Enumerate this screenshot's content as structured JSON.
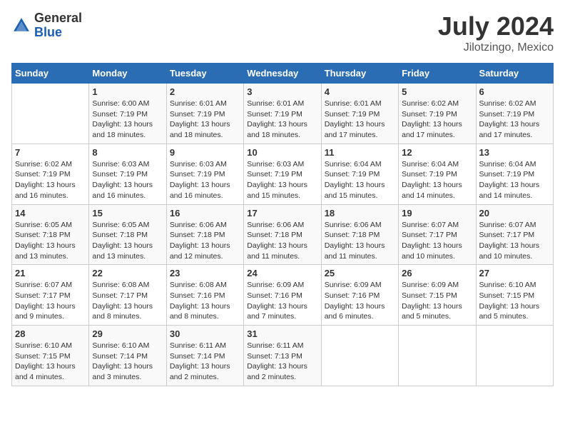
{
  "header": {
    "logo_general": "General",
    "logo_blue": "Blue",
    "month_title": "July 2024",
    "location": "Jilotzingo, Mexico"
  },
  "calendar": {
    "days_of_week": [
      "Sunday",
      "Monday",
      "Tuesday",
      "Wednesday",
      "Thursday",
      "Friday",
      "Saturday"
    ],
    "weeks": [
      [
        {
          "day": "",
          "info": ""
        },
        {
          "day": "1",
          "info": "Sunrise: 6:00 AM\nSunset: 7:19 PM\nDaylight: 13 hours\nand 18 minutes."
        },
        {
          "day": "2",
          "info": "Sunrise: 6:01 AM\nSunset: 7:19 PM\nDaylight: 13 hours\nand 18 minutes."
        },
        {
          "day": "3",
          "info": "Sunrise: 6:01 AM\nSunset: 7:19 PM\nDaylight: 13 hours\nand 18 minutes."
        },
        {
          "day": "4",
          "info": "Sunrise: 6:01 AM\nSunset: 7:19 PM\nDaylight: 13 hours\nand 17 minutes."
        },
        {
          "day": "5",
          "info": "Sunrise: 6:02 AM\nSunset: 7:19 PM\nDaylight: 13 hours\nand 17 minutes."
        },
        {
          "day": "6",
          "info": "Sunrise: 6:02 AM\nSunset: 7:19 PM\nDaylight: 13 hours\nand 17 minutes."
        }
      ],
      [
        {
          "day": "7",
          "info": "Sunrise: 6:02 AM\nSunset: 7:19 PM\nDaylight: 13 hours\nand 16 minutes."
        },
        {
          "day": "8",
          "info": "Sunrise: 6:03 AM\nSunset: 7:19 PM\nDaylight: 13 hours\nand 16 minutes."
        },
        {
          "day": "9",
          "info": "Sunrise: 6:03 AM\nSunset: 7:19 PM\nDaylight: 13 hours\nand 16 minutes."
        },
        {
          "day": "10",
          "info": "Sunrise: 6:03 AM\nSunset: 7:19 PM\nDaylight: 13 hours\nand 15 minutes."
        },
        {
          "day": "11",
          "info": "Sunrise: 6:04 AM\nSunset: 7:19 PM\nDaylight: 13 hours\nand 15 minutes."
        },
        {
          "day": "12",
          "info": "Sunrise: 6:04 AM\nSunset: 7:19 PM\nDaylight: 13 hours\nand 14 minutes."
        },
        {
          "day": "13",
          "info": "Sunrise: 6:04 AM\nSunset: 7:19 PM\nDaylight: 13 hours\nand 14 minutes."
        }
      ],
      [
        {
          "day": "14",
          "info": "Sunrise: 6:05 AM\nSunset: 7:18 PM\nDaylight: 13 hours\nand 13 minutes."
        },
        {
          "day": "15",
          "info": "Sunrise: 6:05 AM\nSunset: 7:18 PM\nDaylight: 13 hours\nand 13 minutes."
        },
        {
          "day": "16",
          "info": "Sunrise: 6:06 AM\nSunset: 7:18 PM\nDaylight: 13 hours\nand 12 minutes."
        },
        {
          "day": "17",
          "info": "Sunrise: 6:06 AM\nSunset: 7:18 PM\nDaylight: 13 hours\nand 11 minutes."
        },
        {
          "day": "18",
          "info": "Sunrise: 6:06 AM\nSunset: 7:18 PM\nDaylight: 13 hours\nand 11 minutes."
        },
        {
          "day": "19",
          "info": "Sunrise: 6:07 AM\nSunset: 7:17 PM\nDaylight: 13 hours\nand 10 minutes."
        },
        {
          "day": "20",
          "info": "Sunrise: 6:07 AM\nSunset: 7:17 PM\nDaylight: 13 hours\nand 10 minutes."
        }
      ],
      [
        {
          "day": "21",
          "info": "Sunrise: 6:07 AM\nSunset: 7:17 PM\nDaylight: 13 hours\nand 9 minutes."
        },
        {
          "day": "22",
          "info": "Sunrise: 6:08 AM\nSunset: 7:17 PM\nDaylight: 13 hours\nand 8 minutes."
        },
        {
          "day": "23",
          "info": "Sunrise: 6:08 AM\nSunset: 7:16 PM\nDaylight: 13 hours\nand 8 minutes."
        },
        {
          "day": "24",
          "info": "Sunrise: 6:09 AM\nSunset: 7:16 PM\nDaylight: 13 hours\nand 7 minutes."
        },
        {
          "day": "25",
          "info": "Sunrise: 6:09 AM\nSunset: 7:16 PM\nDaylight: 13 hours\nand 6 minutes."
        },
        {
          "day": "26",
          "info": "Sunrise: 6:09 AM\nSunset: 7:15 PM\nDaylight: 13 hours\nand 5 minutes."
        },
        {
          "day": "27",
          "info": "Sunrise: 6:10 AM\nSunset: 7:15 PM\nDaylight: 13 hours\nand 5 minutes."
        }
      ],
      [
        {
          "day": "28",
          "info": "Sunrise: 6:10 AM\nSunset: 7:15 PM\nDaylight: 13 hours\nand 4 minutes."
        },
        {
          "day": "29",
          "info": "Sunrise: 6:10 AM\nSunset: 7:14 PM\nDaylight: 13 hours\nand 3 minutes."
        },
        {
          "day": "30",
          "info": "Sunrise: 6:11 AM\nSunset: 7:14 PM\nDaylight: 13 hours\nand 2 minutes."
        },
        {
          "day": "31",
          "info": "Sunrise: 6:11 AM\nSunset: 7:13 PM\nDaylight: 13 hours\nand 2 minutes."
        },
        {
          "day": "",
          "info": ""
        },
        {
          "day": "",
          "info": ""
        },
        {
          "day": "",
          "info": ""
        }
      ]
    ]
  }
}
